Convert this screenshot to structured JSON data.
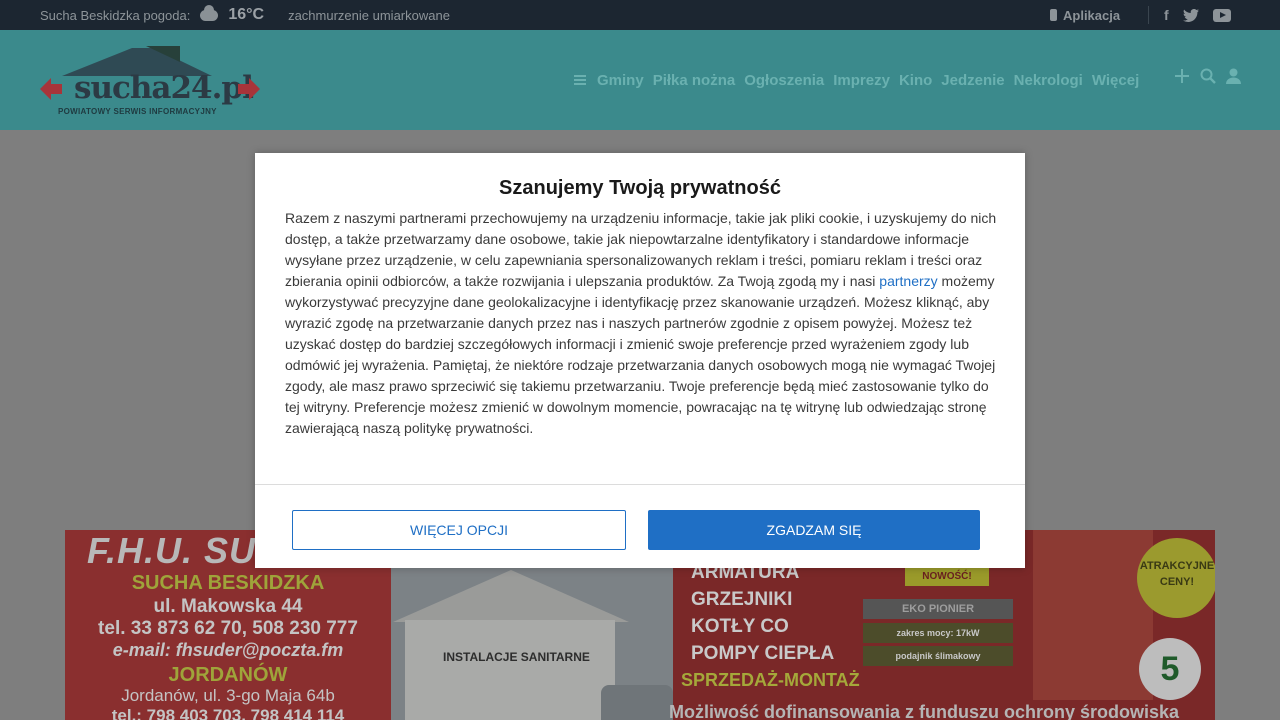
{
  "topbar": {
    "weather_label": "Sucha Beskidzka pogoda:",
    "temperature": "16°C",
    "condition": "zachmurzenie umiarkowane",
    "app_label": "Aplikacja",
    "social": {
      "facebook": "f"
    }
  },
  "header": {
    "logo_text": "sucha24.pl",
    "logo_tagline": "POWIATOWY SERWIS INFORMACYJNY",
    "nav": [
      "Gminy",
      "Piłka nożna",
      "Ogłoszenia",
      "Imprezy",
      "Kino",
      "Jedzenie",
      "Nekrologi",
      "Więcej"
    ]
  },
  "consent": {
    "title": "Szanujemy Twoją prywatność",
    "text_before_link": "Razem z naszymi partnerami przechowujemy na urządzeniu informacje, takie jak pliki cookie, i uzyskujemy do nich dostęp, a także przetwarzamy dane osobowe, takie jak niepowtarzalne identyfikatory i standardowe informacje wysyłane przez urządzenie, w celu zapewniania spersonalizowanych reklam i treści, pomiaru reklam i treści oraz zbierania opinii odbiorców, a także rozwijania i ulepszania produktów. Za Twoją zgodą my i nasi ",
    "link_text": "partnerzy",
    "text_after_link": " możemy wykorzystywać precyzyjne dane geolokalizacyjne i identyfikację przez skanowanie urządzeń. Możesz kliknąć, aby wyrazić zgodę na przetwarzanie danych przez nas i naszych partnerów zgodnie z opisem powyżej. Możesz też uzyskać dostęp do bardziej szczegółowych informacji i zmienić swoje preferencje przed wyrażeniem zgody lub odmówić jej wyrażenia. Pamiętaj, że niektóre rodzaje przetwarzania danych osobowych mogą nie wymagać Twojej zgody, ale masz prawo sprzeciwić się takiemu przetwarzaniu. Twoje preferencje będą mieć zastosowanie tylko do tej witryny. Preferencje możesz zmienić w dowolnym momencie, powracając na tę witrynę lub odwiedzając stronę zawierającą naszą politykę prywatności.",
    "more_options": "WIĘCEJ OPCJI",
    "agree": "ZGADZAM SIĘ"
  },
  "ad": {
    "company": "F.H.U. SU",
    "city": "SUCHA BESKIDZKA",
    "street": "ul. Makowska 44",
    "phone": "tel. 33 873 62 70, 508 230 777",
    "email": "e-mail: fhsuder@poczta.fm",
    "city2": "JORDANÓW",
    "street2": "Jordanów, ul. 3-go Maja 64b",
    "phone2": "tel.: 798 403 703, 798 414 114",
    "shop_sign": "INSTALACJE SANITARNE",
    "products": [
      "ARMATURA",
      "GRZEJNIKI",
      "KOTŁY CO",
      "POMPY CIEPŁA"
    ],
    "sales": "SPRZEDAŻ-MONTAŻ",
    "new_badge": "NOWOŚĆ!",
    "product_name": "EKO PIONIER",
    "power": "zakres mocy: 17kW",
    "feeder": "podajnik ślimakowy",
    "promo": "ATRAKCYJNE CENY!",
    "class_number": "5",
    "bottom": "Możliwość dofinansowania z funduszu ochrony środowiska"
  }
}
